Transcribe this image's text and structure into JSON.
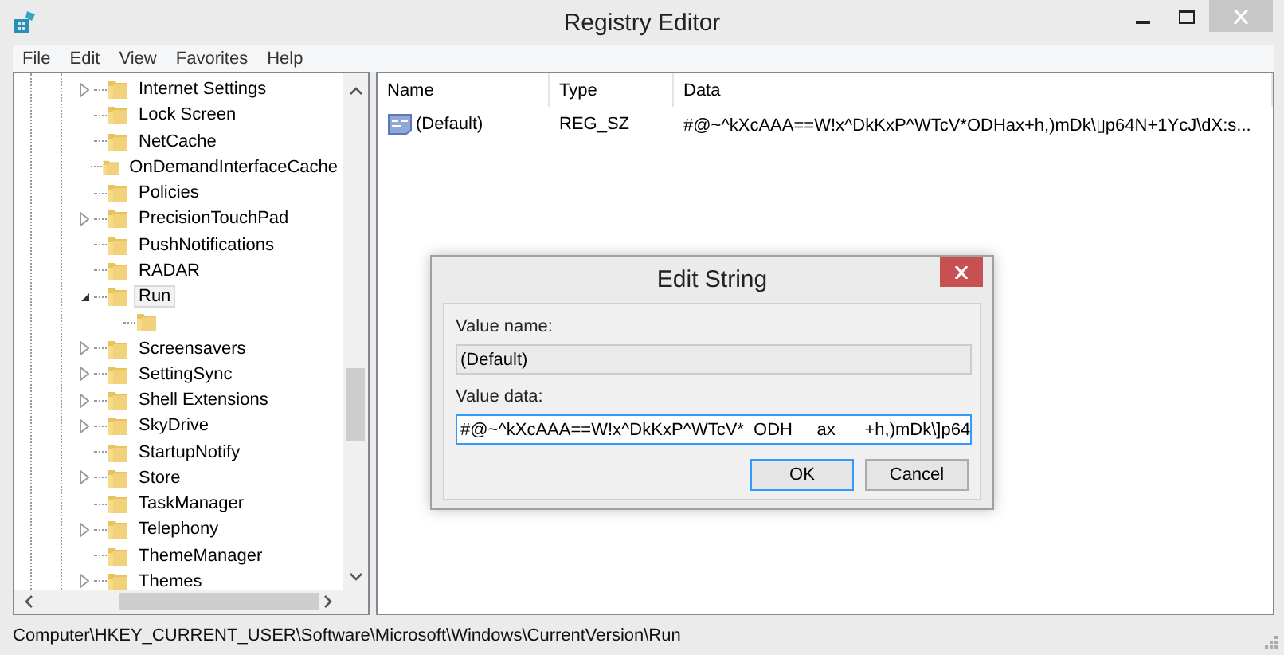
{
  "window": {
    "title": "Registry Editor"
  },
  "menu": [
    "File",
    "Edit",
    "View",
    "Favorites",
    "Help"
  ],
  "tree": [
    {
      "label": "Internet Settings",
      "kind": "branch",
      "expanded": false,
      "selected": false
    },
    {
      "label": "Lock Screen",
      "kind": "leaf",
      "selected": false
    },
    {
      "label": "NetCache",
      "kind": "leaf",
      "selected": false
    },
    {
      "label": "OnDemandInterfaceCache",
      "kind": "leaf",
      "selected": false
    },
    {
      "label": "Policies",
      "kind": "leaf",
      "selected": false
    },
    {
      "label": "PrecisionTouchPad",
      "kind": "branch",
      "expanded": false,
      "selected": false
    },
    {
      "label": "PushNotifications",
      "kind": "leaf",
      "selected": false
    },
    {
      "label": "RADAR",
      "kind": "leaf",
      "selected": false
    },
    {
      "label": "Run",
      "kind": "branch",
      "expanded": true,
      "selected": true,
      "children": [
        {
          "kind": "leaf",
          "selected": false
        }
      ]
    },
    {
      "label": "Screensavers",
      "kind": "branch",
      "expanded": false,
      "selected": false
    },
    {
      "label": "SettingSync",
      "kind": "branch",
      "expanded": false,
      "selected": false
    },
    {
      "label": "Shell Extensions",
      "kind": "branch",
      "expanded": false,
      "selected": false
    },
    {
      "label": "SkyDrive",
      "kind": "branch",
      "expanded": false,
      "selected": false
    },
    {
      "label": "StartupNotify",
      "kind": "leaf",
      "selected": false
    },
    {
      "label": "Store",
      "kind": "branch",
      "expanded": false,
      "selected": false
    },
    {
      "label": "TaskManager",
      "kind": "leaf",
      "selected": false
    },
    {
      "label": "Telephony",
      "kind": "branch",
      "expanded": false,
      "selected": false
    },
    {
      "label": "ThemeManager",
      "kind": "leaf",
      "selected": false
    },
    {
      "label": "Themes",
      "kind": "branch",
      "expanded": false,
      "selected": false
    }
  ],
  "values": {
    "columns": [
      "Name",
      "Type",
      "Data"
    ],
    "rows": [
      {
        "name": "(Default)",
        "type": "REG_SZ",
        "data": "#@~^kXcAAA==W!x^DkKxP^WTcV*ODHax+h,)mDk\\▯p64N+1YcJ\\dX:s..."
      }
    ]
  },
  "dialog": {
    "title": "Edit String",
    "name_label": "Value name:",
    "name_value": "(Default)",
    "data_label": "Value data:",
    "data_value": "#@~^kXcAAA==W!x^DkKxP^WTcV*  ODH     ax      +h,)mDk\\]p64",
    "buttons": [
      "OK",
      "Cancel"
    ]
  },
  "status_bar": "Computer\\HKEY_CURRENT_USER\\Software\\Microsoft\\Windows\\CurrentVersion\\Run"
}
